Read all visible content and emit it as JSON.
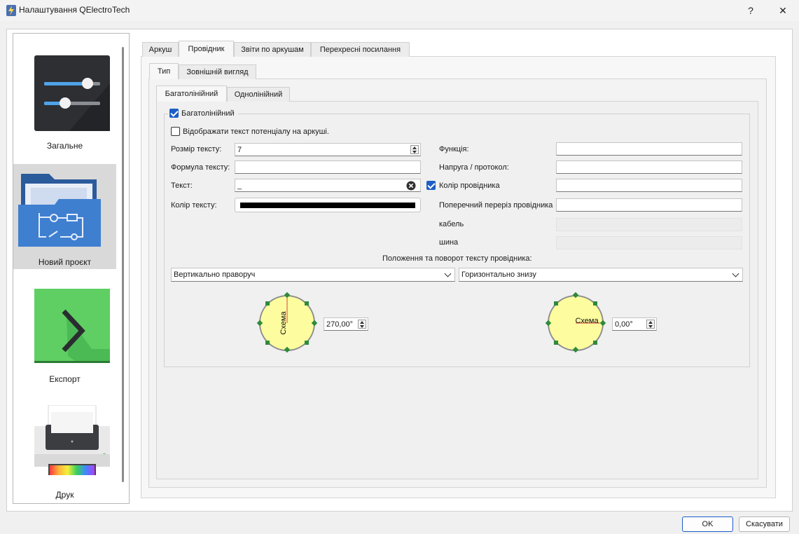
{
  "window": {
    "title": "Налаштування QElectroTech",
    "help_label": "?",
    "close_label": "✕"
  },
  "sidebar": {
    "items": [
      {
        "label": "Загальне"
      },
      {
        "label": "Новий проєкт"
      },
      {
        "label": "Експорт"
      },
      {
        "label": "Друк"
      }
    ]
  },
  "tabs": {
    "main": [
      "Аркуш",
      "Провідник",
      "Звіти по аркушам",
      "Перехресні посилання"
    ],
    "sub": [
      "Тип",
      "Зовнішній вигляд"
    ],
    "type": [
      "Багатолінійний",
      "Однолінійний"
    ]
  },
  "form": {
    "group_title": "Багатолінійний",
    "show_potential_text": "Відображати текст потенціалу на аркуші.",
    "text_size_label": "Розмір тексту:",
    "text_size_value": "7",
    "formula_label": "Формула тексту:",
    "text_label": "Текст:",
    "text_value": "_",
    "text_color_label": "Колір тексту:",
    "text_color": "#000000",
    "function_label": "Функція:",
    "voltage_label": "Напруга / протокол:",
    "conductor_color_label": "Колір провідника",
    "cross_section_label": "Поперечний переріз провідника",
    "cable_label": "кабель",
    "bus_label": "шина",
    "position_title": "Положення та поворот тексту провідника:",
    "vertical_option": "Вертикально праворуч",
    "horizontal_option": "Горизонтально знизу",
    "vertical_angle": "270,00°",
    "horizontal_angle": "0,00°",
    "dial_text": "Схема"
  },
  "buttons": {
    "ok": "OK",
    "cancel": "Скасувати"
  }
}
